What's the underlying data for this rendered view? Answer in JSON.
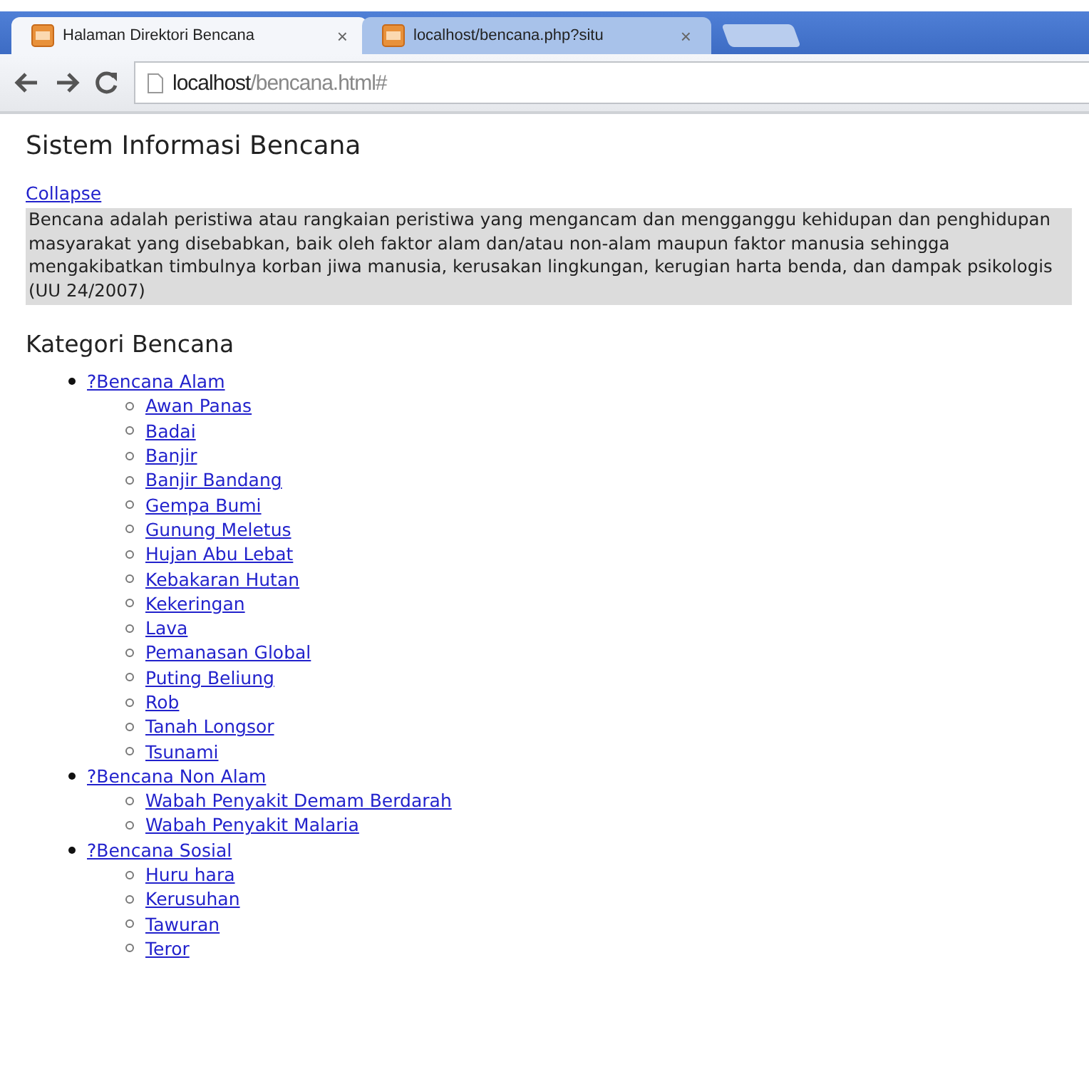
{
  "browser": {
    "tabs": [
      {
        "title": "Halaman Direktori Bencana",
        "close": "×",
        "selected": true
      },
      {
        "title": "localhost/bencana.php?situ",
        "close": "×",
        "selected": false
      }
    ],
    "address": {
      "host": "localhost",
      "path": "/bencana.html#"
    }
  },
  "page": {
    "title": "Sistem Informasi Bencana",
    "toggle": "Collapse",
    "description": "Bencana adalah peristiwa atau rangkaian peristiwa yang mengancam dan mengganggu kehidupan dan penghidupan masyarakat yang disebabkan, baik oleh faktor alam dan/atau non-alam maupun faktor manusia sehingga mengakibatkan timbulnya korban jiwa manusia, kerusakan lingkungan, kerugian harta benda, dan dampak psikologis (UU 24/2007)",
    "category_heading": "Kategori Bencana",
    "categories": [
      {
        "label": "?Bencana Alam",
        "children": [
          {
            "label": "Awan Panas"
          },
          {
            "label": "Badai"
          },
          {
            "label": "Banjir"
          },
          {
            "label": "Banjir Bandang"
          },
          {
            "label": "Gempa Bumi"
          },
          {
            "label": "Gunung Meletus"
          },
          {
            "label": "Hujan Abu Lebat"
          },
          {
            "label": "Kebakaran Hutan"
          },
          {
            "label": "Kekeringan"
          },
          {
            "label": "Lava"
          },
          {
            "label": "Pemanasan Global"
          },
          {
            "label": "Puting Beliung"
          },
          {
            "label": "Rob"
          },
          {
            "label": "Tanah Longsor"
          },
          {
            "label": "Tsunami"
          }
        ]
      },
      {
        "label": "?Bencana Non Alam",
        "children": [
          {
            "label": "Wabah Penyakit Demam Berdarah"
          },
          {
            "label": "Wabah Penyakit Malaria"
          }
        ]
      },
      {
        "label": "?Bencana Sosial",
        "children": [
          {
            "label": "Huru hara"
          },
          {
            "label": "Kerusuhan"
          },
          {
            "label": "Tawuran"
          },
          {
            "label": "Teror"
          }
        ]
      }
    ]
  }
}
